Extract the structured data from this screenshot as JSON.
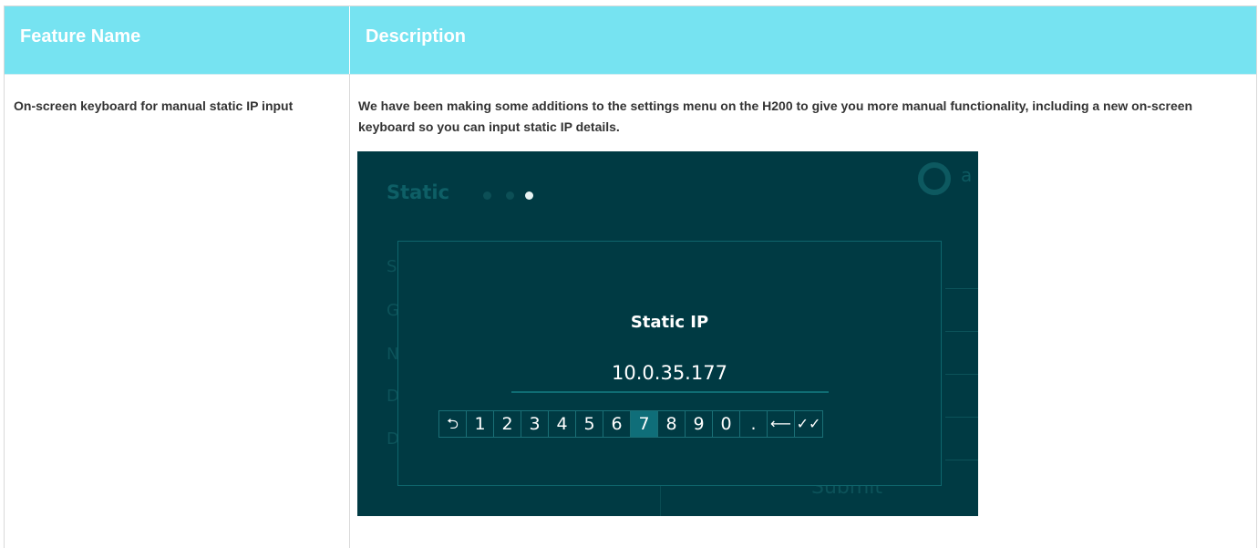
{
  "table": {
    "headers": {
      "feature": "Feature Name",
      "description": "Description"
    },
    "rows": [
      {
        "feature": "On-screen keyboard for manual static IP input",
        "description": "We have been making some additions to the settings menu on the H200 to give you more manual functionality, including a new on-screen keyboard so you can input static IP details."
      }
    ]
  },
  "screenshot": {
    "background_title": "Static",
    "logo_letter": "a",
    "background_letters": [
      "S",
      "G",
      "N",
      "D",
      "D"
    ],
    "submit_label": "Submit",
    "dialog": {
      "title": "Static IP",
      "value": "10.0.35.177",
      "keys": [
        "⮌",
        "1",
        "2",
        "3",
        "4",
        "5",
        "6",
        "7",
        "8",
        "9",
        "0",
        ".",
        "⟵",
        "✓✓"
      ],
      "selected_key": "7"
    },
    "colors": {
      "header": "#76e3f1",
      "screen_bg": "#003a43",
      "selected_key": "#0f6e79"
    }
  }
}
